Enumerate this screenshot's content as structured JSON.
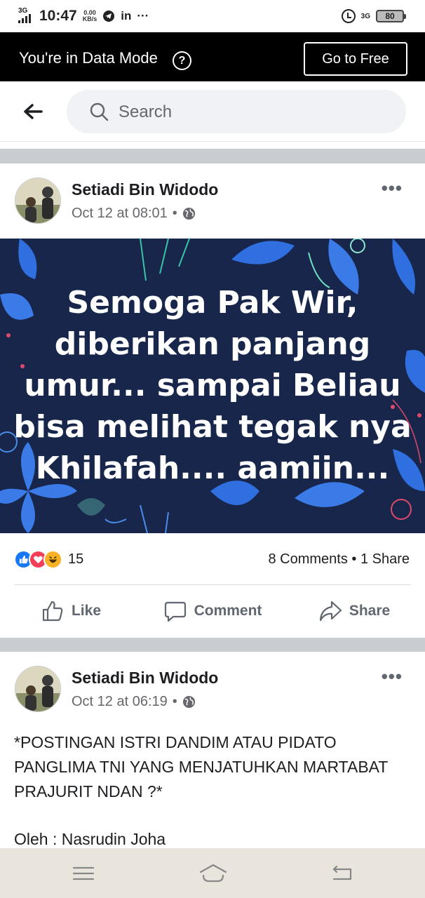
{
  "status_bar": {
    "network_left": "3G",
    "time": "10:47",
    "speed_value": "0.00",
    "speed_unit": "KB/s",
    "icons": [
      "telegram-icon",
      "linkedin-icon",
      "more-notifications-icon"
    ],
    "linkedin": "in",
    "more": "···",
    "network_right": "3G",
    "battery": "80"
  },
  "data_mode": {
    "message": "You're in Data Mode",
    "help": "?",
    "cta": "Go to Free"
  },
  "search": {
    "placeholder": "Search"
  },
  "posts": [
    {
      "author": "Setiadi Bin Widodo",
      "time": "Oct 12 at 08:01",
      "separator": "•",
      "more": "•••",
      "image_text": "Semoga Pak Wir,\ndiberikan panjang\numur... sampai Beliau\nbisa melihat tegak nya\nKhilafah.... aamiin...",
      "reactions": [
        "like",
        "love",
        "haha"
      ],
      "reaction_count": "15",
      "comments_shares": "8 Comments • 1 Share",
      "actions": {
        "like": "Like",
        "comment": "Comment",
        "share": "Share"
      },
      "colors": {
        "image_bg": "#17264a",
        "leaf_blue": "#2f6fe0",
        "like_blue": "#1877f2",
        "love_red": "#f33e58",
        "haha_yellow": "#f7b125"
      }
    },
    {
      "author": "Setiadi Bin Widodo",
      "time": "Oct 12 at 06:19",
      "separator": "•",
      "more": "•••",
      "text": "*POSTINGAN ISTRI DANDIM ATAU PIDATO PANGLIMA TNI YANG MENJATUHKAN MARTABAT PRAJURIT  NDAN ?*",
      "byline": "Oleh : Nasrudin Joha"
    }
  ],
  "nav_bar": {
    "buttons": [
      "menu-icon",
      "home-icon",
      "back-icon"
    ]
  }
}
